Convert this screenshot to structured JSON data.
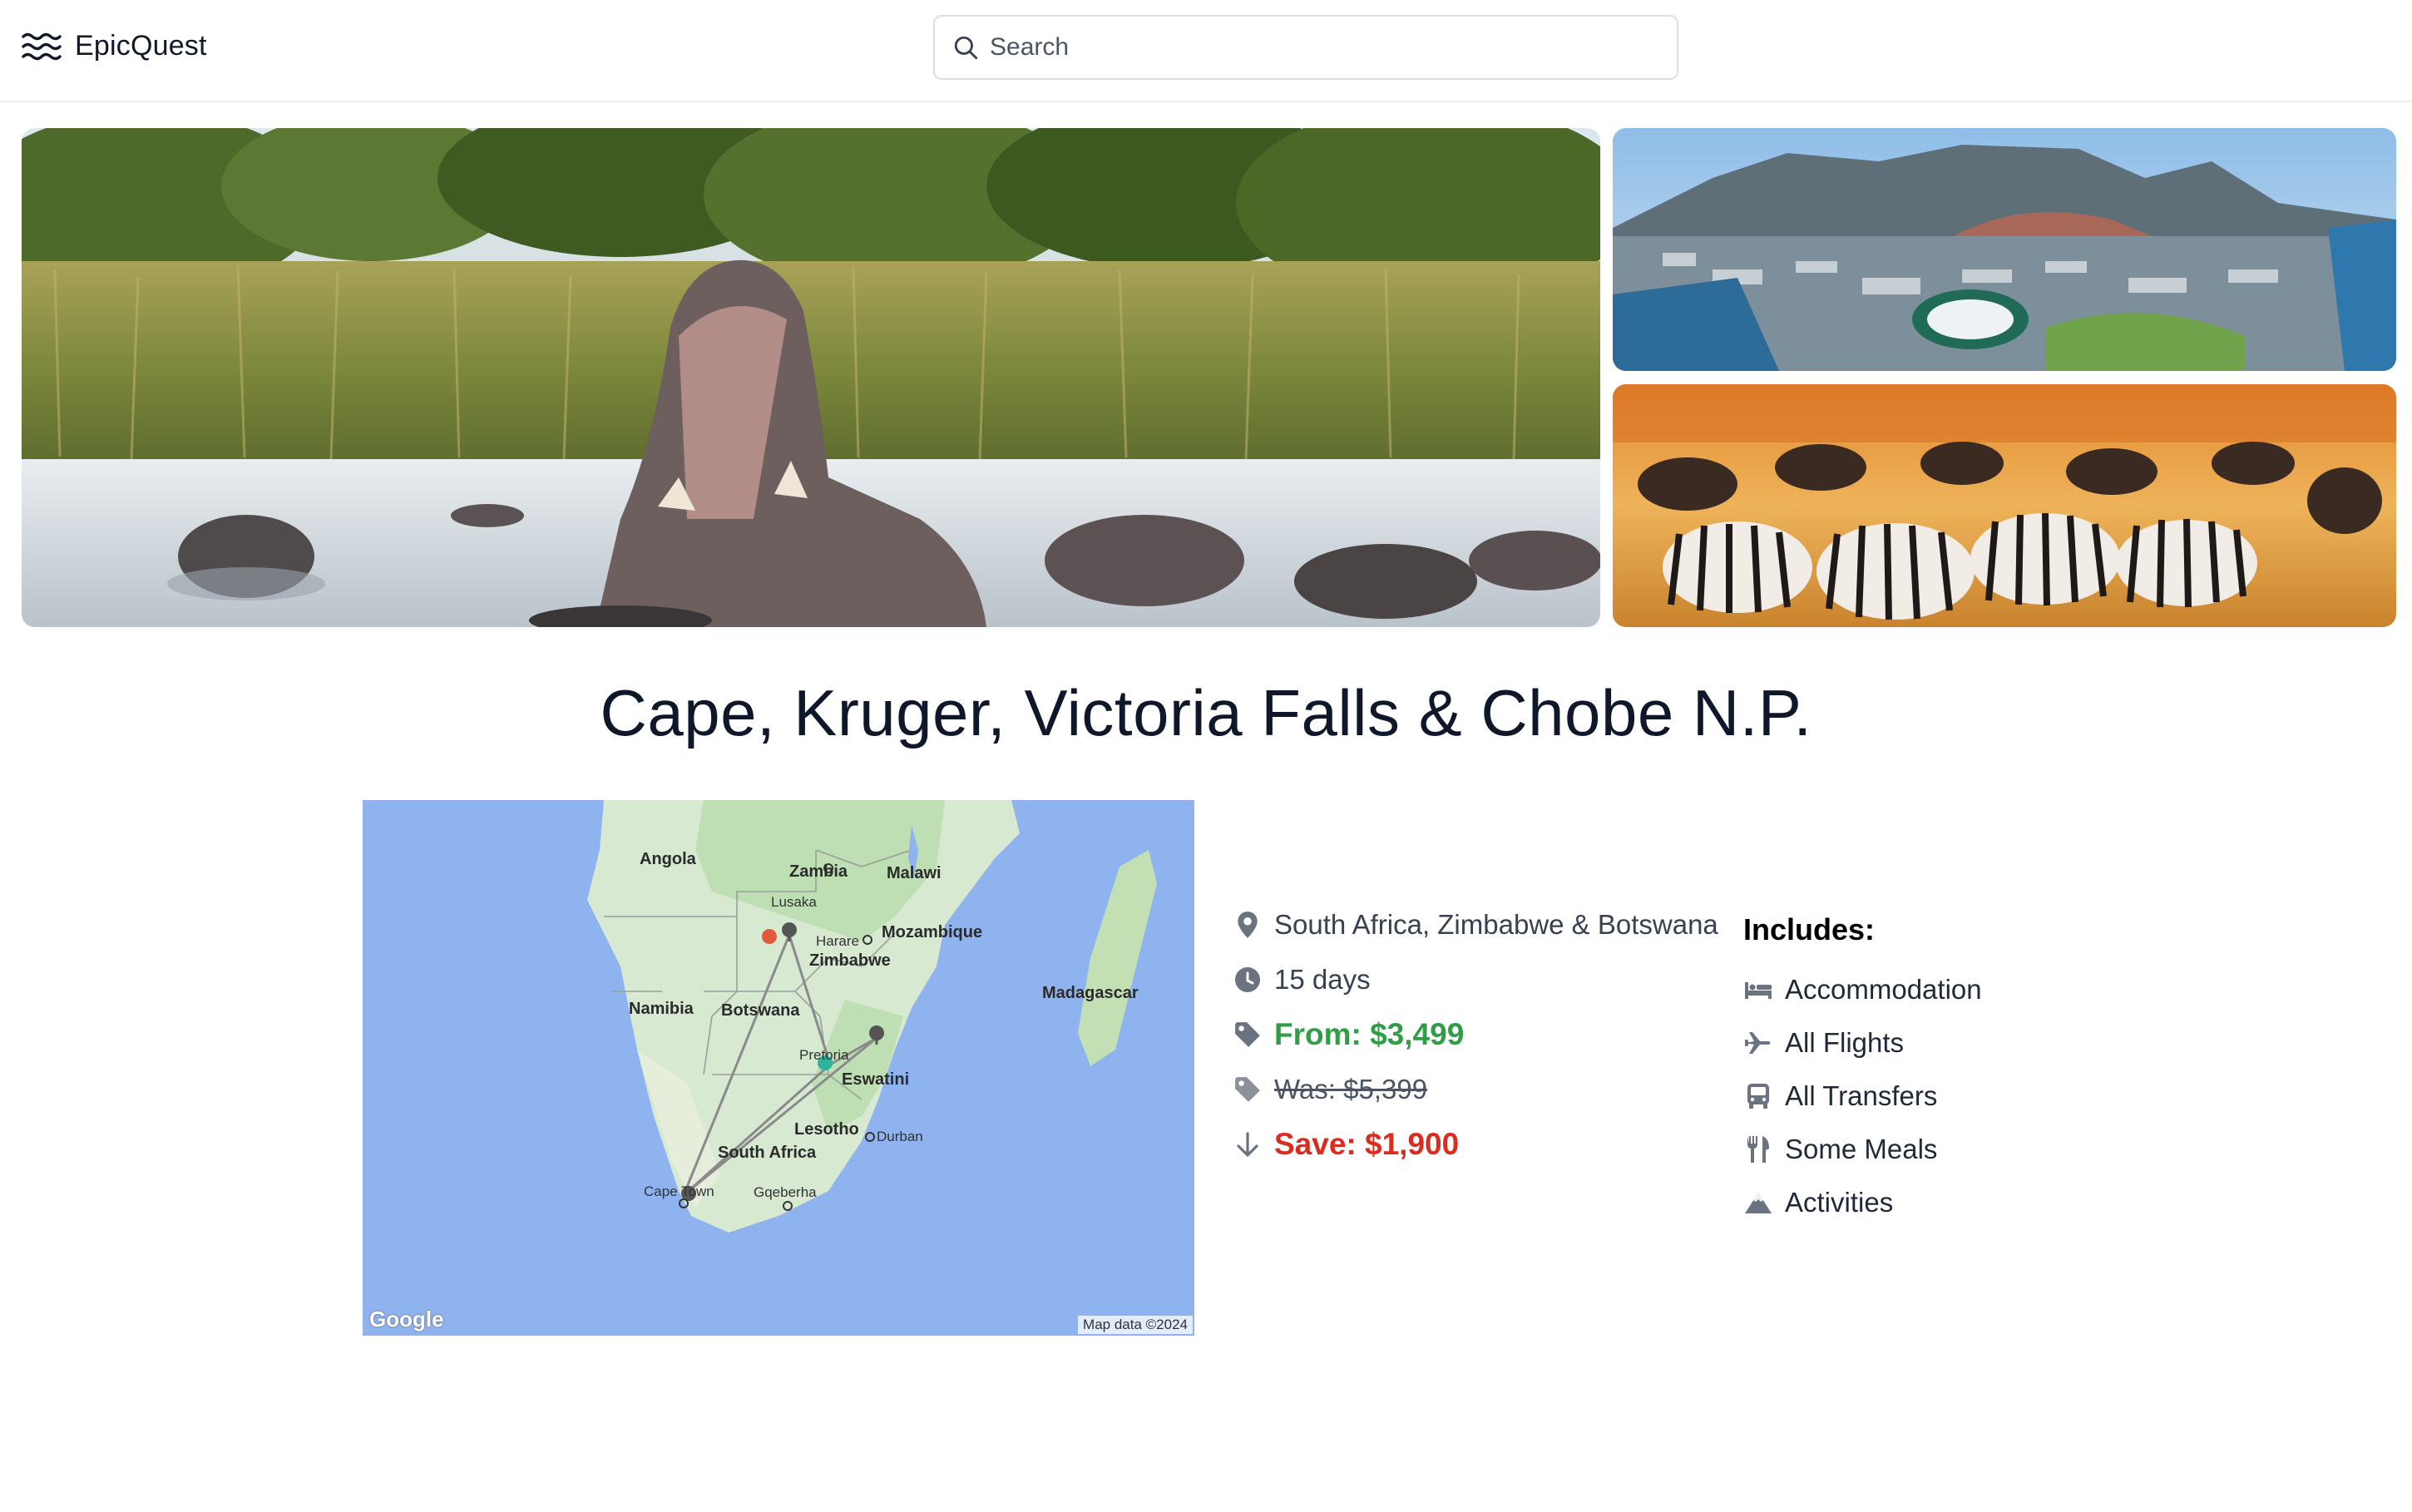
{
  "header": {
    "brand": "EpicQuest",
    "search": {
      "placeholder": "Search"
    }
  },
  "gallery": [
    {
      "name": "hippos-river-photo"
    },
    {
      "name": "cape-town-aerial-photo"
    },
    {
      "name": "zebras-wildebeest-photo"
    }
  ],
  "tour": {
    "title": "Cape, Kruger, Victoria Falls & Chobe N.P.",
    "countries": "South Africa, Zimbabwe & Botswana",
    "duration": "15 days",
    "price_from": "From: $3,499",
    "price_was": "Was: $5,399",
    "savings": "Save: $1,900"
  },
  "map": {
    "labels": {
      "angola": "Angola",
      "zambia": "Zambia",
      "malawi": "Malawi",
      "lusaka": "Lusaka",
      "mozambique": "Mozambique",
      "harare": "Harare",
      "zimbabwe": "Zimbabwe",
      "madagascar": "Madagascar",
      "namibia": "Namibia",
      "botswana": "Botswana",
      "pretoria": "Pretoria",
      "eswatini": "Eswatini",
      "lesotho": "Lesotho",
      "durban": "Durban",
      "south_africa": "South Africa",
      "cape_town": "Cape Town",
      "gqeberha": "Gqeberha"
    },
    "brand": "Google",
    "attribution": "Map data ©2024"
  },
  "includes": {
    "title": "Includes:",
    "items": [
      {
        "label": "Accommodation",
        "icon": "bed-icon"
      },
      {
        "label": "All Flights",
        "icon": "plane-icon"
      },
      {
        "label": "All Transfers",
        "icon": "bus-icon"
      },
      {
        "label": "Some Meals",
        "icon": "utensils-icon"
      },
      {
        "label": "Activities",
        "icon": "mountain-icon"
      }
    ]
  },
  "colors": {
    "price_green": "#2f9e44",
    "save_red": "#d92d20",
    "icon_gray": "#6b7280",
    "ocean": "#8fb3ee",
    "land": "#d7ead1"
  }
}
